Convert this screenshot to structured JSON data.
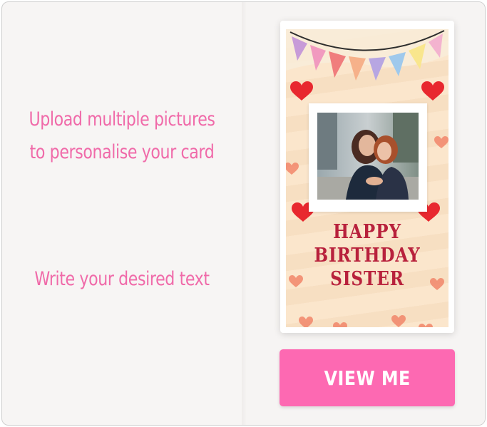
{
  "features": {
    "upload_line1": "Upload multiple pictures",
    "upload_line2": "to personalise your card",
    "write_text": "Write your desired text"
  },
  "card": {
    "greeting_line1": "HAPPY",
    "greeting_line2": "BIRTHDAY",
    "greeting_line3": "SISTER"
  },
  "actions": {
    "view_label": "VIEW ME"
  },
  "colors": {
    "accent_pink": "#fd69b2",
    "feature_text_pink": "#f06aa9",
    "greeting_red": "#b8213c"
  },
  "icons": [
    "bunting-decoration",
    "heart-icon"
  ]
}
